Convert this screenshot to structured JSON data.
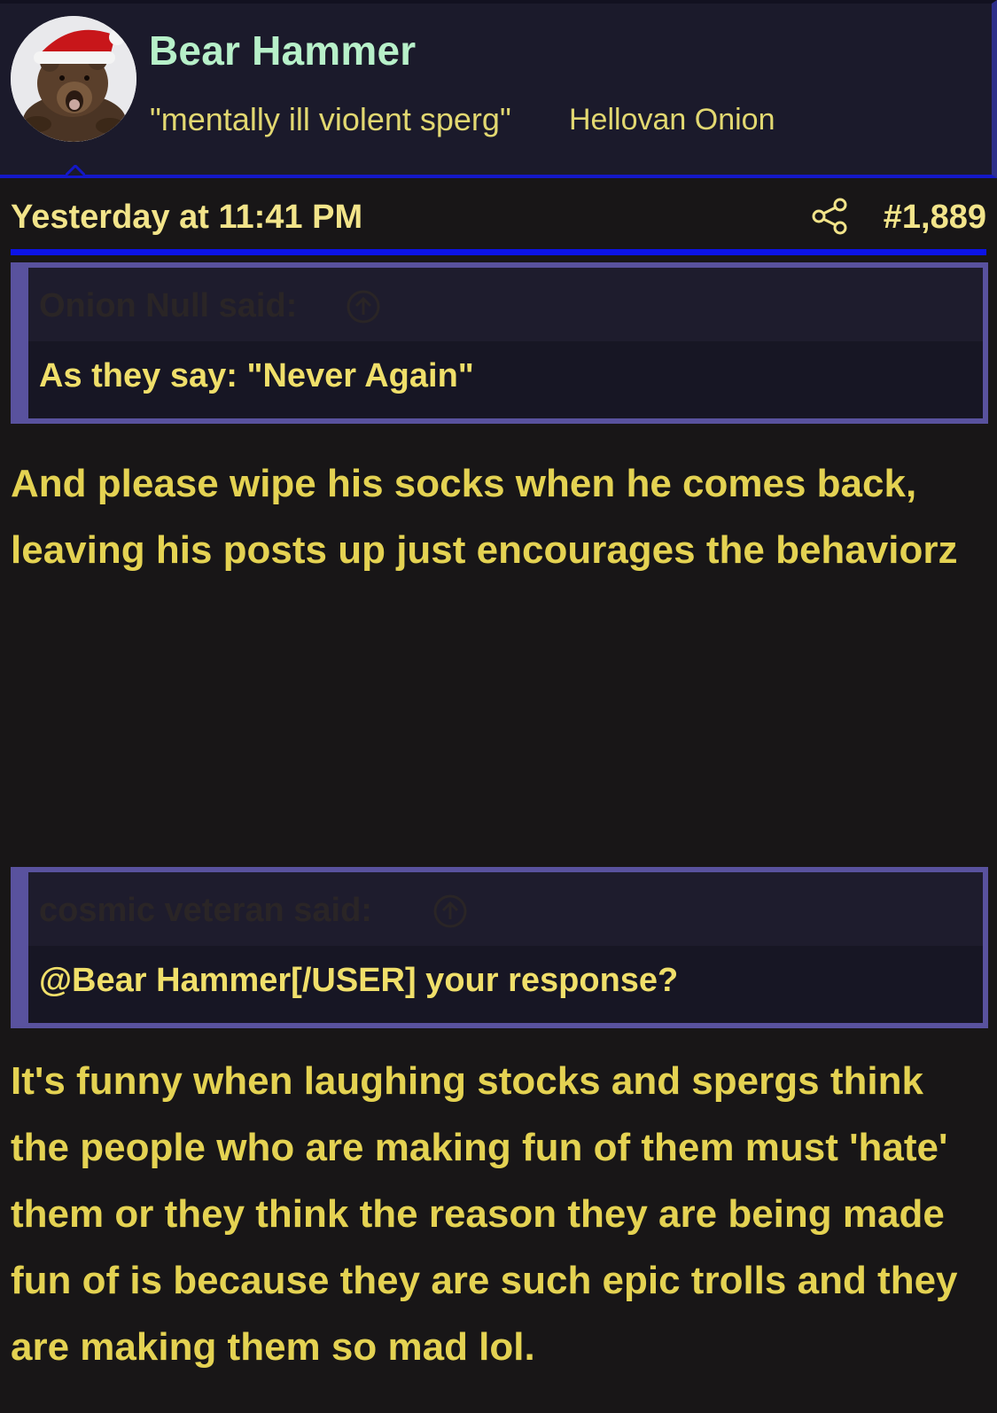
{
  "user": {
    "name": "Bear Hammer",
    "title": "\"mentally ill violent sperg\"",
    "banner": "Hellovan Onion",
    "avatar_icon": "bear-with-santa-hat"
  },
  "post": {
    "date": "Yesterday at 11:41 PM",
    "share_icon": "share-icon",
    "number": "#1,889"
  },
  "quotes": [
    {
      "author": "Onion Null said:",
      "text": "As they say: \"Never Again\""
    },
    {
      "author": "cosmic veteran said:",
      "text": "@Bear Hammer[/USER] your response?"
    }
  ],
  "body": [
    "And please wipe his socks when he comes back, leaving his posts up just encourages the behaviorz",
    "It's funny when laughing stocks and spergs think the people who are making fun of them must 'hate' them or they think the reason they are being made fun of is because they are such epic trolls and they are making them so mad lol."
  ],
  "colors": {
    "background": "#181617",
    "header_bg": "#1b1a2b",
    "username": "#b7f0c9",
    "text_yellow": "#e4d252",
    "accent_blue": "#0c13e6",
    "quote_border": "#59529e"
  }
}
